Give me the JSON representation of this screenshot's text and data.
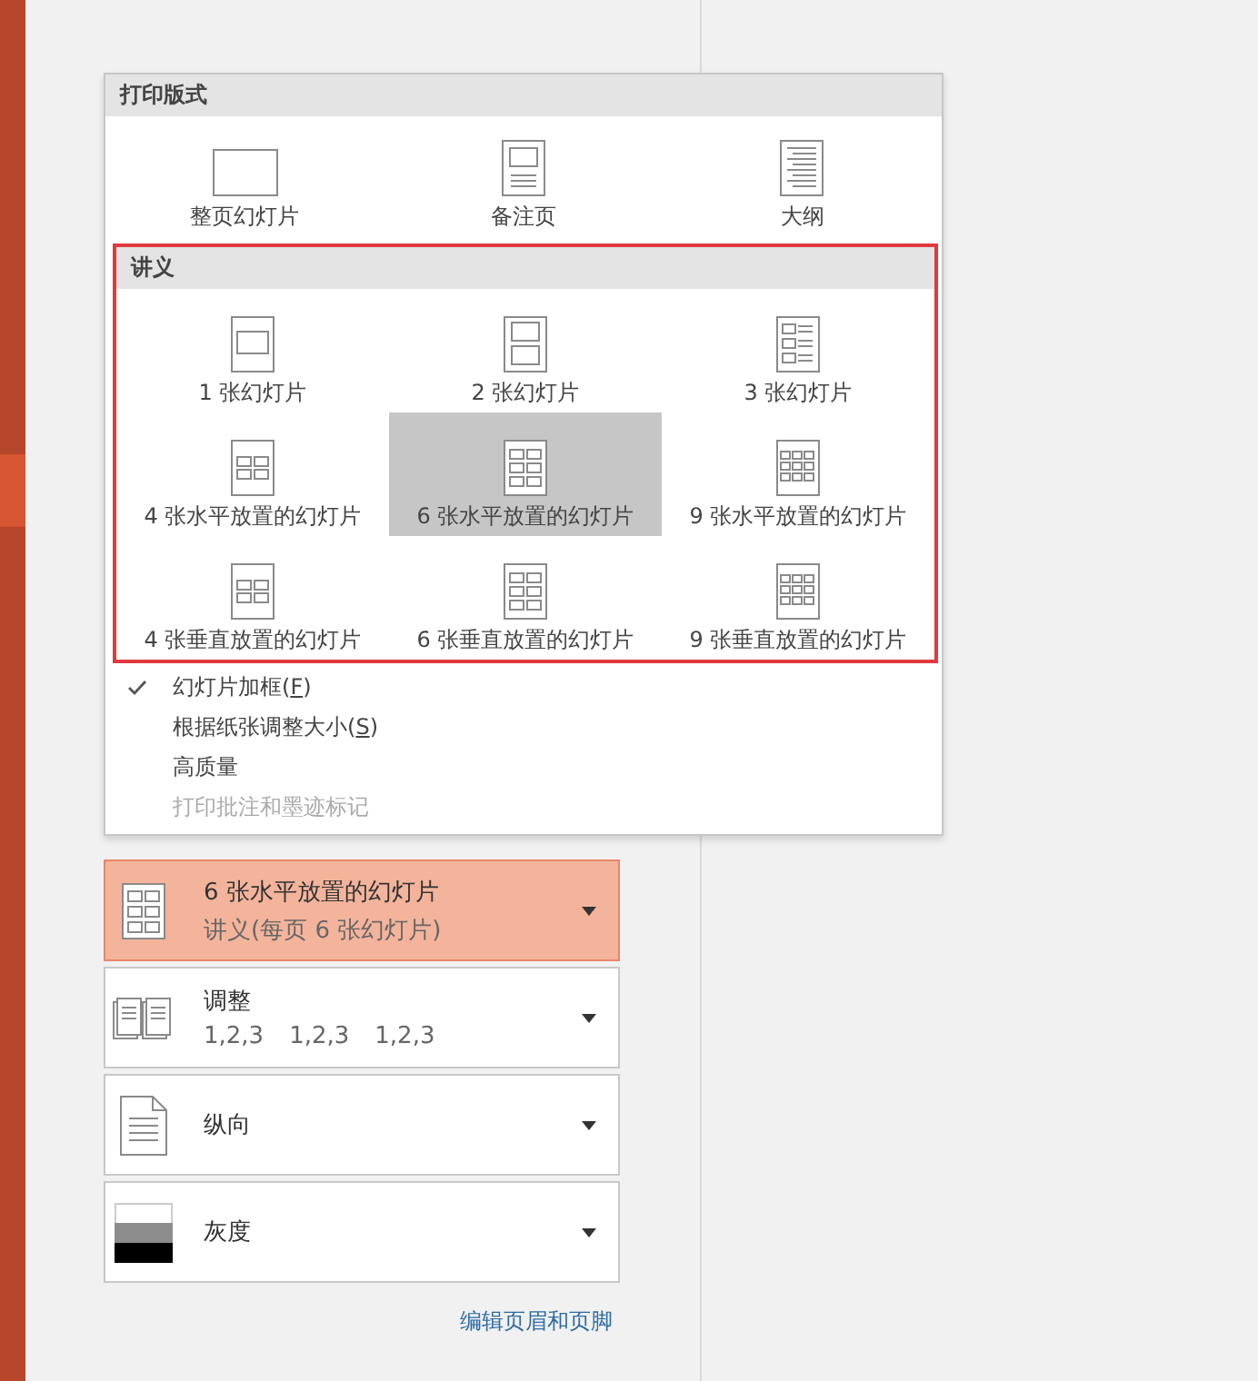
{
  "print_layout": {
    "heading": "打印版式",
    "options": [
      {
        "kind": "full",
        "label": "整页幻灯片",
        "selected": false
      },
      {
        "kind": "notes",
        "label": "备注页",
        "selected": false
      },
      {
        "kind": "outline",
        "label": "大纲",
        "selected": false
      }
    ]
  },
  "handouts": {
    "heading": "讲义",
    "highlighted": true,
    "options": [
      {
        "kind": "h1",
        "label": "1 张幻灯片",
        "selected": false
      },
      {
        "kind": "h2",
        "label": "2 张幻灯片",
        "selected": false
      },
      {
        "kind": "h3",
        "label": "3 张幻灯片",
        "selected": false
      },
      {
        "kind": "h4",
        "label": "4 张水平放置的幻灯片",
        "selected": false
      },
      {
        "kind": "h6",
        "label": "6 张水平放置的幻灯片",
        "selected": true
      },
      {
        "kind": "h9",
        "label": "9 张水平放置的幻灯片",
        "selected": false
      },
      {
        "kind": "v4",
        "label": "4 张垂直放置的幻灯片",
        "selected": false
      },
      {
        "kind": "v6",
        "label": "6 张垂直放置的幻灯片",
        "selected": false
      },
      {
        "kind": "v9",
        "label": "9 张垂直放置的幻灯片",
        "selected": false
      }
    ]
  },
  "toggles": [
    {
      "label": "幻灯片加框(",
      "access_key": "F",
      "label_end": ")",
      "checked": true,
      "disabled": false
    },
    {
      "label": "根据纸张调整大小(",
      "access_key": "S",
      "label_end": ")",
      "checked": false,
      "disabled": false
    },
    {
      "label": "高质量",
      "checked": false,
      "disabled": false
    },
    {
      "label": "打印批注和墨迹标记",
      "checked": false,
      "disabled": true
    }
  ],
  "settings": [
    {
      "kind": "handout",
      "title": "6 张水平放置的幻灯片",
      "details": [
        "讲义(每页 6 张幻灯片)"
      ],
      "selected": true
    },
    {
      "kind": "collate",
      "title": "调整",
      "details": [
        "1,2,3",
        "1,2,3",
        "1,2,3"
      ],
      "selected": false
    },
    {
      "kind": "orientation",
      "title": "纵向",
      "selected": false
    },
    {
      "kind": "color",
      "title": "灰度",
      "selected": false
    }
  ],
  "footer_link": "编辑页眉和页脚"
}
